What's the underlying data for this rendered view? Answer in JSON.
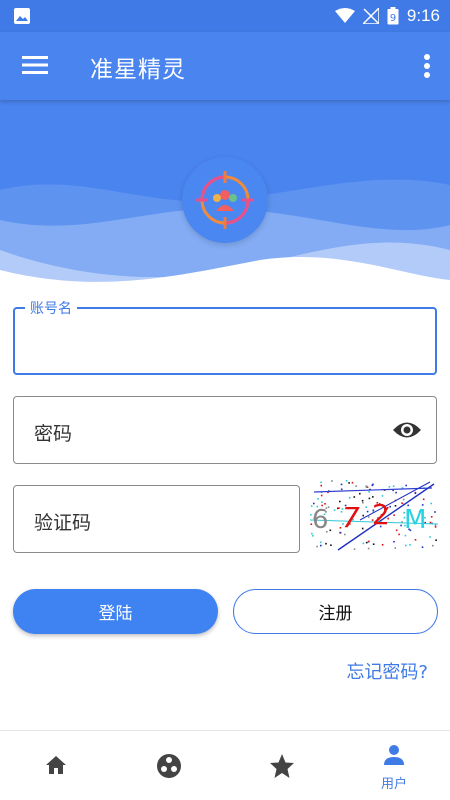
{
  "status_bar": {
    "time": "9:16",
    "battery_level": "9",
    "icons": [
      "image-icon",
      "wifi-icon",
      "no-signal-icon",
      "battery-icon"
    ]
  },
  "app_bar": {
    "title": "准星精灵",
    "icons": [
      "menu-icon",
      "more-vert-icon"
    ]
  },
  "form": {
    "username_label": "账号名",
    "username_value": "",
    "password_placeholder": "密码",
    "captcha_placeholder": "验证码",
    "captcha_chars": [
      "6",
      "7",
      "2",
      "M"
    ],
    "captcha_colors": [
      "#888888",
      "#e01010",
      "#e01010",
      "#29d2e0"
    ]
  },
  "buttons": {
    "login": "登陆",
    "register": "注册"
  },
  "forgot_password": "忘记密码?",
  "bottom_nav": {
    "items": [
      {
        "icon": "home-icon",
        "label": "",
        "active": false
      },
      {
        "icon": "circle-dots-icon",
        "label": "",
        "active": false
      },
      {
        "icon": "star-icon",
        "label": "",
        "active": false
      },
      {
        "icon": "person-icon",
        "label": "用户",
        "active": true
      }
    ]
  },
  "colors": {
    "primary": "#4a84ee",
    "status_bar": "#3f7ae6",
    "accent_button": "#3f83f3",
    "inactive_icon": "#444444"
  }
}
